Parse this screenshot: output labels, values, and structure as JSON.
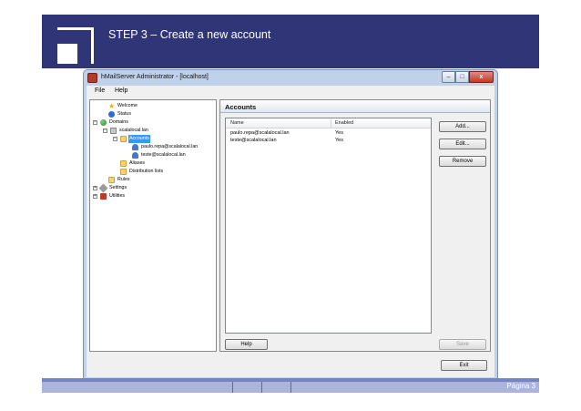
{
  "slide": {
    "title": "STEP 3 – Create a new account",
    "page_number": "Página 3"
  },
  "window": {
    "title": "hMailServer Administrator - [localhost]",
    "controls": {
      "minimize": "–",
      "maximize": "□",
      "close": "x"
    }
  },
  "menu": {
    "file": "File",
    "help": "Help"
  },
  "tree": {
    "welcome": "Welcome",
    "status": "Status",
    "domains": "Domains",
    "domain": "scalalocal.lan",
    "accounts": "Accounts",
    "account_1": "paulo.repa@scalalocal.lan",
    "account_2": "teste@scalalocal.lan",
    "aliases": "Aliases",
    "distribution_lists": "Distribution lists",
    "rules": "Rules",
    "settings": "Settings",
    "utilities": "Utilities"
  },
  "accounts_panel": {
    "title": "Accounts",
    "columns": {
      "name": "Name",
      "enabled": "Enabled"
    },
    "rows": [
      {
        "name": "paulo.repa@scalalocal.lan",
        "enabled": "Yes"
      },
      {
        "name": "teste@scalalocal.lan",
        "enabled": "Yes"
      }
    ],
    "buttons": {
      "add": "Add...",
      "edit": "Edit...",
      "remove": "Remove",
      "help": "Help",
      "save": "Save"
    }
  },
  "footer_buttons": {
    "exit": "Exit"
  },
  "colors": {
    "slide_header": "#2f3577",
    "slide_footer": "#aab4dd",
    "window_frame": "#bfd2ea",
    "selection": "#3399ff"
  },
  "icons": {
    "welcome": "star-icon",
    "status": "status-icon",
    "domains": "globe-icon",
    "domain": "server-icon",
    "folders": "folder-icon",
    "accounts": "user-icon",
    "settings": "tools-icon",
    "utilities": "utilities-icon"
  }
}
